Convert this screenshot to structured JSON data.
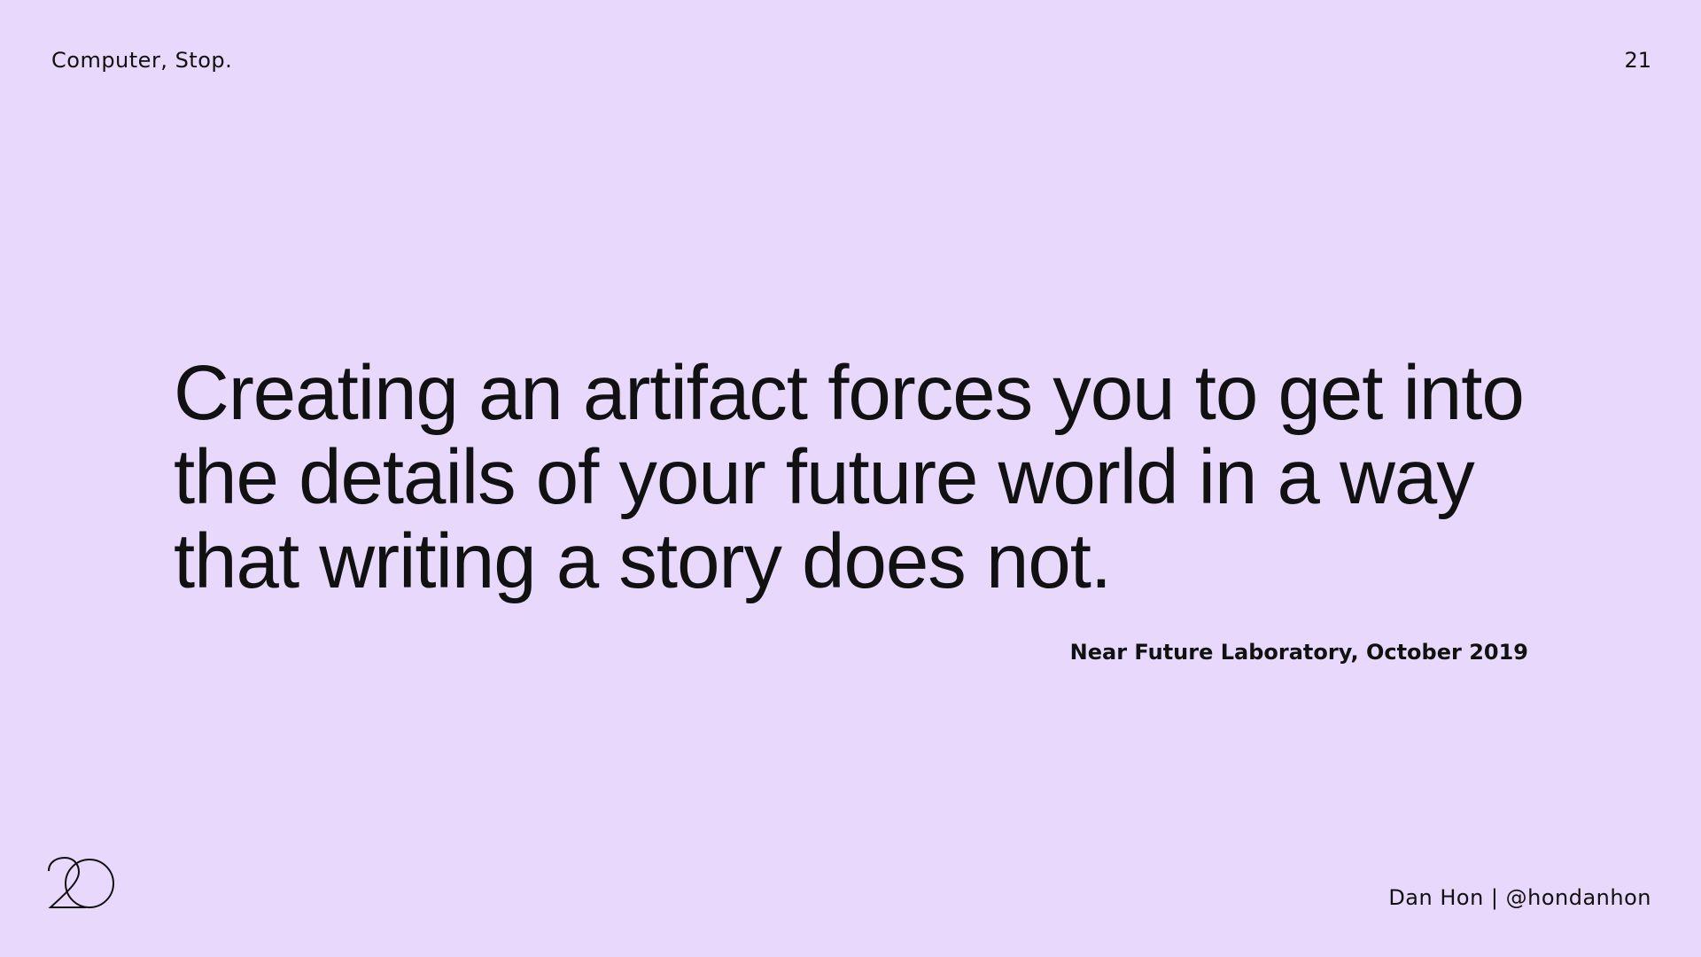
{
  "header": {
    "title": "Computer, Stop.",
    "slide_number": "21"
  },
  "quote": {
    "lines": [
      "Creating an artifact forces you to get into",
      "the details of your future world in a way",
      "that writing a story does not."
    ],
    "attribution": "Near Future Laboratory, October 2019"
  },
  "footer": {
    "author": "Dan Hon | @hondanhon",
    "logo_text": "20",
    "logo_icon": "logo-20-icon"
  },
  "colors": {
    "background": "#e8d9fc",
    "text": "#111111"
  }
}
